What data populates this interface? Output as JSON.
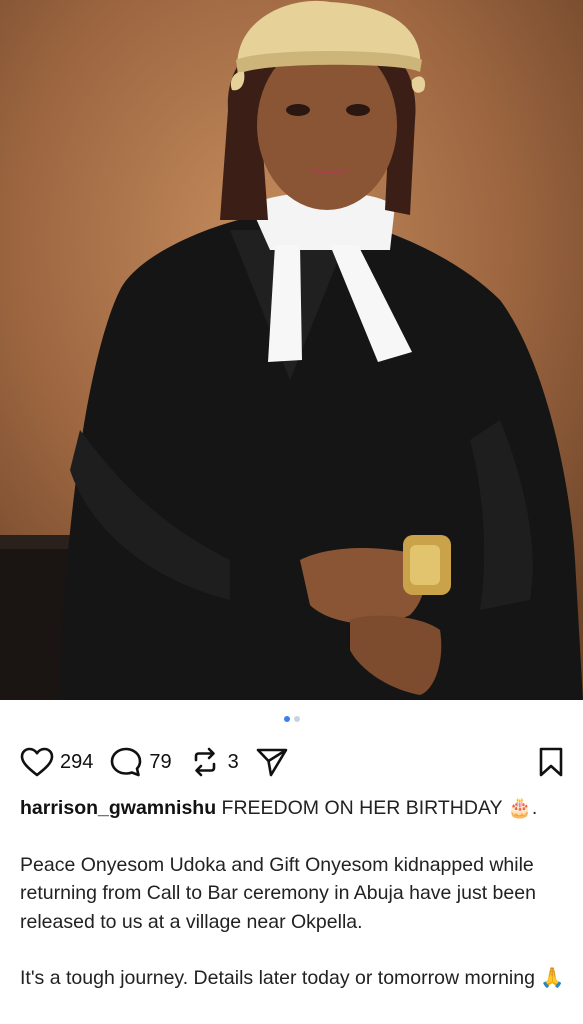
{
  "post": {
    "carousel": {
      "count": 2,
      "active": 0
    },
    "actions": {
      "likes": "294",
      "comments": "79",
      "reposts": "3"
    },
    "caption": {
      "username": "harrison_gwamnishu",
      "headline": "FREEDOM ON HER BIRTHDAY",
      "headline_emoji": "🎂",
      "headline_end": ".",
      "paragraph1": "Peace Onyesom Udoka and Gift Onyesom kidnapped while returning from Call to Bar ceremony in Abuja have just been released to us at a village near Okpella.",
      "paragraph2": "It's a tough journey.  Details later today or tomorrow morning",
      "paragraph2_emoji": "🙏"
    }
  },
  "icons": [
    "heart-icon",
    "comment-icon",
    "repost-icon",
    "share-icon",
    "bookmark-icon"
  ],
  "colors": {
    "carousel_active": "#3a7ef0",
    "carousel_inactive": "#c9d3e0",
    "text": "#111111"
  }
}
